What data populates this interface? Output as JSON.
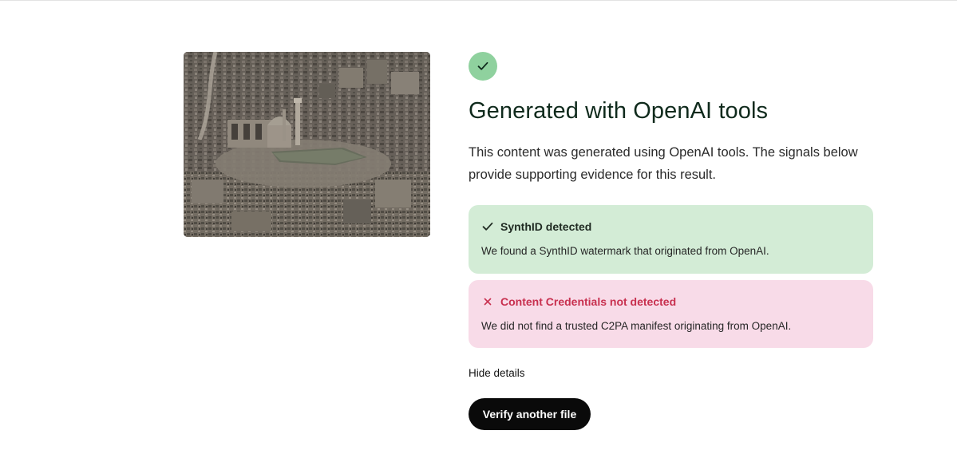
{
  "thumbnail": {
    "alt": "Aerial view of a destroyed city with a mosque among rubble"
  },
  "result": {
    "status_icon": "check-icon",
    "title": "Generated with OpenAI tools",
    "description": "This content was generated using OpenAI tools. The signals below provide supporting evidence for this result."
  },
  "signals": [
    {
      "icon": "check-icon",
      "label": "SynthID detected",
      "detail": "We found a SynthID watermark that originated from OpenAI.",
      "status": "detected",
      "bg_color": "#d3ecd6"
    },
    {
      "icon": "close-icon",
      "label": "Content Credentials not detected",
      "detail": "We did not find a trusted C2PA manifest originating from OpenAI.",
      "status": "not-detected",
      "bg_color": "#f8dbe8",
      "label_color": "#c8304f"
    }
  ],
  "actions": {
    "hide_details": "Hide details",
    "verify_another": "Verify another file"
  },
  "colors": {
    "status_circle": "#8fd19e",
    "title": "#0f2a1c",
    "button_bg": "#0a0a0a"
  }
}
